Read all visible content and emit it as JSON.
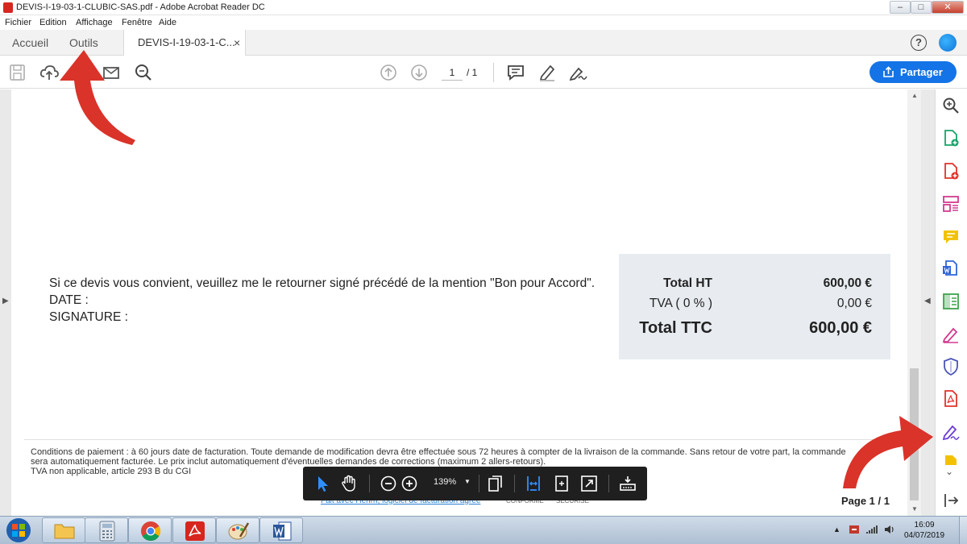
{
  "window": {
    "title": "DEVIS-I-19-03-1-CLUBIC-SAS.pdf - Adobe Acrobat Reader DC",
    "controls": [
      "minimize",
      "maximize",
      "close"
    ]
  },
  "menu": [
    "Fichier",
    "Edition",
    "Affichage",
    "Fenêtre",
    "Aide"
  ],
  "tabs": {
    "home": "Accueil",
    "tools": "Outils",
    "document": "DEVIS-I-19-03-1-C...",
    "close_glyph": "×"
  },
  "toolbar": {
    "icons": [
      "save-icon",
      "cloud-upload-icon",
      "email-icon",
      "zoom-search-icon",
      "page-up-icon",
      "page-down-icon",
      "comment-icon",
      "highlight-pen-icon",
      "sign-icon"
    ],
    "current_page": "1",
    "page_total": "/ 1",
    "share_label": "Partager"
  },
  "document": {
    "message_line": "Si ce devis vous convient, veuillez me le retourner signé précédé de la mention \"Bon pour Accord\".",
    "date_label": "DATE :",
    "signature_label": "SIGNATURE :",
    "totals": [
      {
        "label": "Total HT",
        "value": "600,00 €"
      },
      {
        "label": "TVA ( 0 % )",
        "value": "0,00 €"
      },
      {
        "label": "Total TTC",
        "value": "600,00 €"
      }
    ],
    "footer_line1": "Conditions de paiement : à 60 jours date de facturation. Toute demande de modification devra être effectuée sous 72 heures à compter de la livraison de la commande. Sans retour de votre part, la commande",
    "footer_line2": "sera automatiquement facturée.  Le prix inclut automatiquement d'éventuelles demandes de corrections (maximum 2 allers-retours).",
    "footer_line3": "TVA non applicable, article 293 B du CGI",
    "footer_link": "Fait avec Henrri, logiciel de facturation agréé",
    "footer_badge1": "CONFORME",
    "footer_badge2": "SÉCURISÉ",
    "page_indicator": "Page 1 / 1"
  },
  "floating_toolbar": {
    "zoom": "139%",
    "icons": [
      "select-cursor-icon",
      "hand-pan-icon",
      "zoom-out-icon",
      "zoom-in-icon",
      "zoom-dropdown-icon",
      "page-display-icon",
      "fit-width-icon",
      "fit-page-icon",
      "full-screen-icon",
      "read-mode-icon"
    ]
  },
  "right_panel": {
    "icons": [
      "zoom-search-icon",
      "create-pdf-icon",
      "export-pdf-icon",
      "organize-pages-icon",
      "comment-icon",
      "export-word-icon",
      "edit-pdf-icon",
      "fill-sign-icon",
      "protect-icon",
      "pdf-icon",
      "sign-icon",
      "more-tools-icon",
      "chevron-down-icon",
      "collapse-panel-icon"
    ],
    "colors": {
      "teal": "#17a36b",
      "red": "#e0332b",
      "pink": "#d43a8f",
      "yellow": "#f2c200",
      "blue": "#2f66d8",
      "green": "#3fa34d",
      "purple": "#6a3fd8",
      "darkblue": "#4a55b5"
    }
  },
  "taskbar": {
    "apps": [
      "start-orb",
      "file-explorer",
      "calculator",
      "chrome",
      "acrobat",
      "paint",
      "word"
    ],
    "time": "16:09",
    "date": "04/07/2019"
  },
  "accent": "#1473e6",
  "annotation_arrow_color": "#d9332a"
}
